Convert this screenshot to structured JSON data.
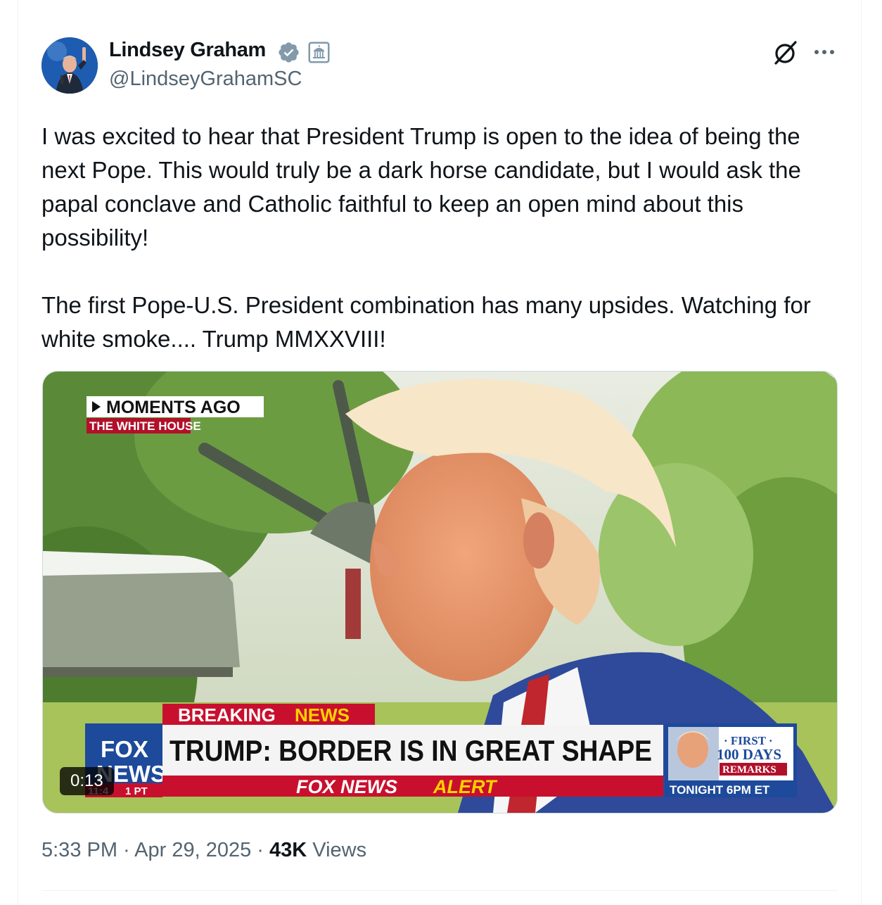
{
  "author": {
    "name": "Lindsey Graham",
    "handle": "@LindseyGrahamSC"
  },
  "icons": {
    "verified": "verified-badge-icon",
    "affiliation": "government-building-icon",
    "grok": "grok-icon",
    "more": "more-options-icon"
  },
  "tweet": {
    "paragraph1": "I was excited to hear that President Trump is open to the idea of being the next Pope. This would truly be a dark horse candidate, but I would ask the papal conclave and Catholic faithful to keep an open mind about this possibility!",
    "paragraph2": "The first Pope-U.S. President combination has many upsides. Watching for white smoke.... Trump MMXXVIII!"
  },
  "video": {
    "duration": "0:13",
    "tag_moments": "MOMENTS AGO",
    "tag_location": "THE WHITE HOUSE",
    "breaking": "BREAKING",
    "news": "NEWS",
    "headline": "TRUMP: BORDER IS IN GREAT SHAPE",
    "alert_brand": "FOX NEWS",
    "alert": "ALERT",
    "logo_line1": "FOX",
    "logo_line2": "NEWS",
    "clock": "11:4",
    "clock_zone": "1 PT",
    "promo_line1": "· FIRST ·",
    "promo_line2": "100 DAYS",
    "promo_line3": "REMARKS",
    "promo_line4": "TONIGHT 6PM ET"
  },
  "meta": {
    "time": "5:33 PM",
    "sep1": " · ",
    "date": "Apr 29, 2025",
    "sep2": " · ",
    "views_count": "43K",
    "views_label": " Views"
  },
  "colors": {
    "text_primary": "#0f1419",
    "text_secondary": "#536471",
    "verified_blue": "#829aab",
    "fox_red": "#c8102e",
    "fox_blue": "#1d4a9a"
  }
}
